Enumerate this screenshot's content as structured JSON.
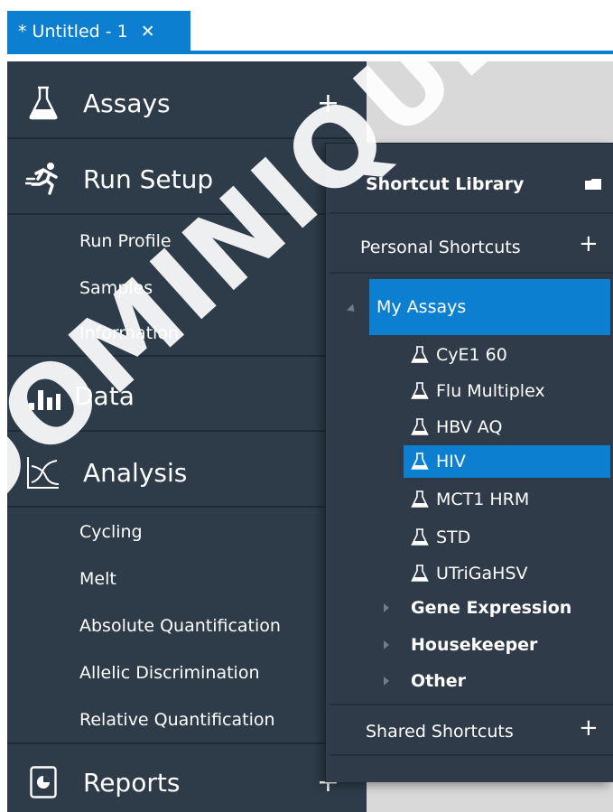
{
  "tab": {
    "title": "* Untitled - 1",
    "close": "✕"
  },
  "nav": {
    "assays": {
      "label": "Assays",
      "plus": "+"
    },
    "run_setup": {
      "label": "Run Setup",
      "items": [
        "Run Profile",
        "Samples",
        "Information"
      ]
    },
    "data": {
      "label": "Data"
    },
    "analysis": {
      "label": "Analysis",
      "items": [
        "Cycling",
        "Melt",
        "Absolute Quantification",
        "Allelic Discrimination",
        "Relative Quantification"
      ]
    },
    "reports": {
      "label": "Reports",
      "plus": "+"
    }
  },
  "shortcut_library": {
    "title": "Shortcut Library",
    "personal": {
      "label": "Personal Shortcuts",
      "plus": "+"
    },
    "my_assays": {
      "label": "My Assays",
      "items": [
        "CyE1 60",
        "Flu Multiplex",
        "HBV AQ",
        "HIV",
        "MCT1 HRM",
        "STD",
        "UTriGaHSV"
      ],
      "selected": "HIV"
    },
    "groups": [
      "Gene Expression",
      "Housekeeper",
      "Other"
    ],
    "shared": {
      "label": "Shared Shortcuts",
      "plus": "+"
    }
  },
  "watermark": "DOMINIQUE DUVAL",
  "colors": {
    "accent": "#0c7fd0",
    "nav_bg": "#2e3c49",
    "panel_bg": "#2f3b48",
    "content_bg": "#d9d9d9"
  }
}
